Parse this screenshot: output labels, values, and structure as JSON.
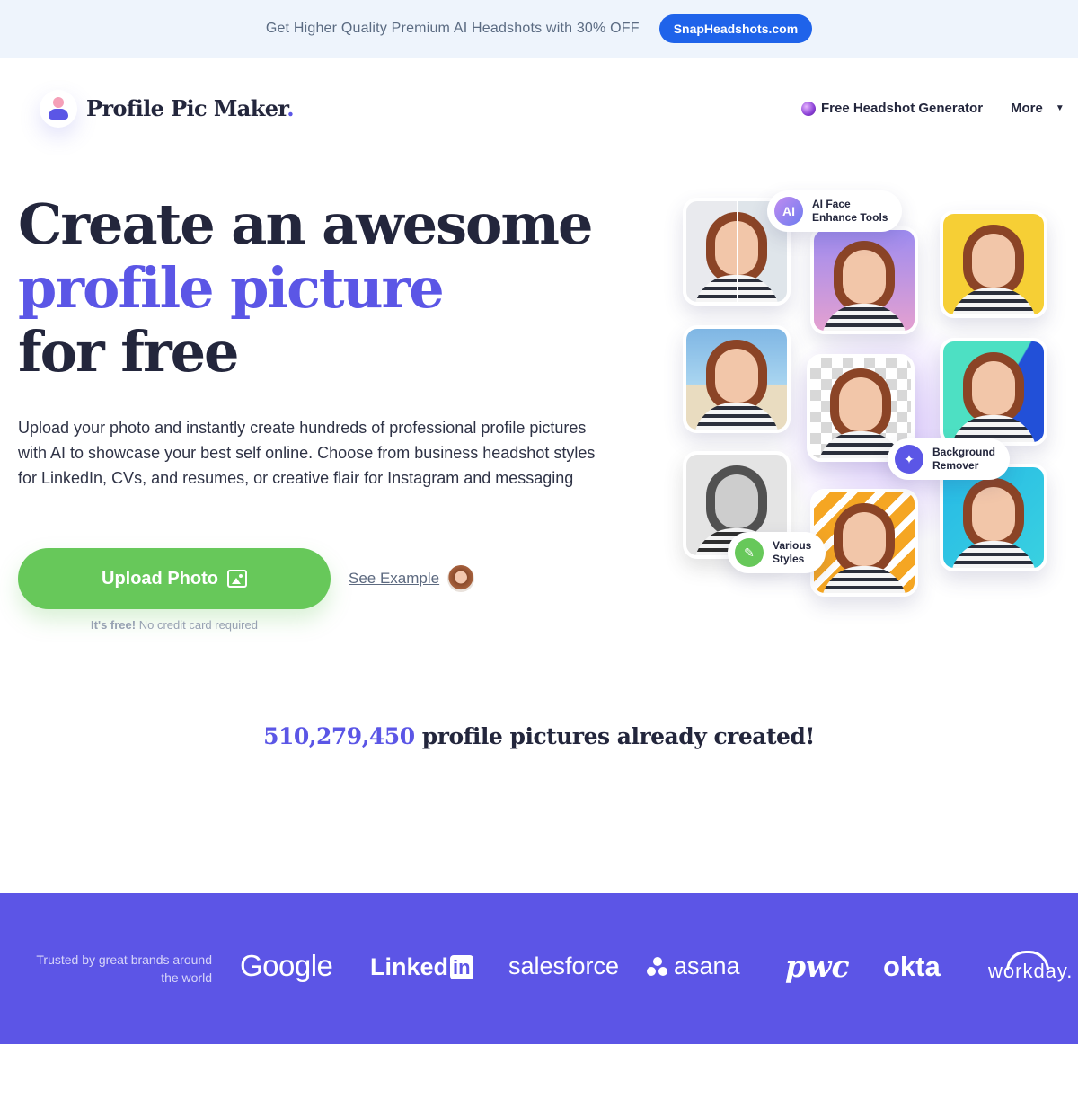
{
  "promo": {
    "text": "Get Higher Quality Premium AI Headshots with 30% OFF",
    "button": "SnapHeadshots.com"
  },
  "nav": {
    "logo_text": "Profile Pic Maker",
    "logo_dot": ".",
    "headshot_link": "Free Headshot Generator",
    "more_link": "More",
    "more_caret": "▼"
  },
  "hero": {
    "title_line1": "Create an awesome",
    "title_line2": "profile picture",
    "title_line3": "for free",
    "description": "Upload your photo and instantly create hundreds of professional profile pictures with AI to showcase your best self online. Choose from business headshot styles for LinkedIn, CVs, and resumes, or creative flair for Instagram and messaging",
    "upload_button": "Upload Photo",
    "see_example": "See Example",
    "free_bold": "It's free!",
    "free_rest": " No credit card required"
  },
  "collage": {
    "badge_ai_icon": "AI",
    "badge_ai_line1": "AI Face",
    "badge_ai_line2": "Enhance Tools",
    "badge_bg_line1": "Background",
    "badge_bg_line2": "Remover",
    "badge_styles_line1": "Various",
    "badge_styles_line2": "Styles"
  },
  "counter": {
    "number": "510,279,450",
    "text": " profile pictures already created!"
  },
  "brands": {
    "trusted_text": "Trusted by great brands around the world",
    "google": "Google",
    "linkedin_text": "Linked",
    "linkedin_in": "in",
    "salesforce": "salesforce",
    "asana": "asana",
    "pwc": "pwc",
    "okta": "okta",
    "workday": "workday."
  },
  "colors": {
    "accent": "#5b56e6",
    "cta_green": "#67c85a",
    "promo_button": "#1f63ea",
    "brand_band": "#5c55e6"
  }
}
